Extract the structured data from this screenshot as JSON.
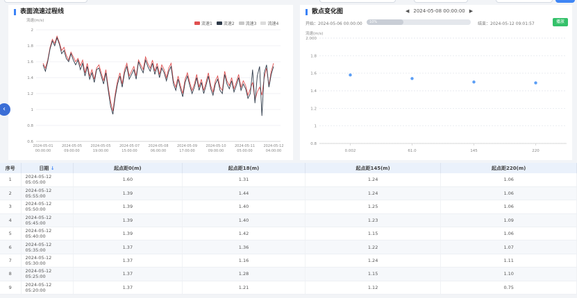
{
  "colors": {
    "accent": "#3b82f6",
    "series_red": "#e05050",
    "series_dark": "#2f3b4a",
    "series_gray1": "#c8c8c8",
    "series_gray2": "#dcdcdc",
    "scatter_point": "#5b9ef5",
    "detail_button": "#34c16a"
  },
  "left_panel": {
    "title": "表面流速过程线",
    "legend": [
      "流速1",
      "流速2",
      "流速3",
      "流速4"
    ]
  },
  "right_panel": {
    "title": "散点变化图",
    "date_nav": {
      "prev_icon": "chevron-left-icon",
      "date": "2024-05-08 00:00:00",
      "next_icon": "chevron-right-icon"
    },
    "start_label": "开始：2024-05-06 00:00:00",
    "slider_tag": "10%",
    "slider_fraction": 0.35,
    "end_label": "结束：2024-05-12 09:01:57",
    "detail_button": "播放"
  },
  "chart_data": [
    {
      "type": "line",
      "ylabel": "流速(m/s)",
      "ylim": [
        0.6,
        2.0
      ],
      "yticks": [
        "2",
        "1.8",
        "1.6",
        "1.4",
        "1.2",
        "1",
        "0.8",
        "0.6"
      ],
      "x_tick_dates": [
        "2024-05-01",
        "2024-05-05",
        "2024-05-05",
        "2024-05-07",
        "2024-05-08",
        "2024-05-09",
        "2024-05-10",
        "2024-05-11",
        "2024-05-12"
      ],
      "x_tick_times": [
        "00:00:00",
        "09:00:00",
        "19:00:00",
        "15:00:00",
        "06:00:00",
        "17:00:00",
        "09:00:00",
        "05:00:00",
        "04:00:00"
      ],
      "series": [
        {
          "color": "#e05050",
          "values": [
            1.58,
            1.52,
            1.62,
            1.78,
            1.88,
            1.83,
            1.92,
            1.84,
            1.74,
            1.78,
            1.68,
            1.62,
            1.72,
            1.66,
            1.6,
            1.64,
            1.55,
            1.62,
            1.46,
            1.58,
            1.42,
            1.5,
            1.38,
            1.52,
            1.56,
            1.46,
            1.36,
            1.5,
            1.28,
            1.1,
            0.98,
            1.2,
            1.36,
            1.46,
            1.32,
            1.5,
            1.58,
            1.42,
            1.48,
            1.54,
            1.42,
            1.62,
            1.56,
            1.5,
            1.66,
            1.58,
            1.52,
            1.62,
            1.48,
            1.58,
            1.44,
            1.56,
            1.5,
            1.4,
            1.52,
            1.58,
            1.36,
            1.28,
            1.42,
            1.3,
            1.2,
            1.38,
            1.46,
            1.34,
            1.24,
            1.32,
            1.44,
            1.28,
            1.38,
            1.24,
            1.34,
            1.46,
            1.3,
            1.22,
            1.36,
            1.42,
            1.28,
            1.24,
            1.48,
            1.36,
            1.3,
            1.4,
            1.26,
            1.34,
            1.44,
            1.28,
            1.36,
            1.3,
            1.18,
            1.26,
            1.34,
            1.12,
            1.22,
            1.28,
            1.18,
            1.4,
            1.52,
            1.3,
            1.48,
            1.58
          ]
        },
        {
          "color": "#2f3b4a",
          "values": [
            1.56,
            1.48,
            1.6,
            1.76,
            1.86,
            1.8,
            1.9,
            1.82,
            1.7,
            1.74,
            1.64,
            1.6,
            1.7,
            1.62,
            1.56,
            1.62,
            1.5,
            1.58,
            1.42,
            1.54,
            1.38,
            1.46,
            1.34,
            1.5,
            1.52,
            1.42,
            1.32,
            1.46,
            1.24,
            1.04,
            0.94,
            1.16,
            1.32,
            1.42,
            1.28,
            1.46,
            1.54,
            1.38,
            1.44,
            1.5,
            1.38,
            1.6,
            1.52,
            1.46,
            1.62,
            1.54,
            1.48,
            1.58,
            1.44,
            1.54,
            1.4,
            1.52,
            1.46,
            1.36,
            1.48,
            1.54,
            1.32,
            1.24,
            1.38,
            1.26,
            1.16,
            1.34,
            1.42,
            1.3,
            1.2,
            1.28,
            1.4,
            1.24,
            1.34,
            1.2,
            1.3,
            1.42,
            1.26,
            1.18,
            1.32,
            1.38,
            1.24,
            1.2,
            1.44,
            1.32,
            1.26,
            1.36,
            1.22,
            1.3,
            1.4,
            1.24,
            1.32,
            1.26,
            1.14,
            1.2,
            1.5,
            1.08,
            1.42,
            1.54,
            0.92,
            1.46,
            1.56,
            1.28,
            1.44,
            1.54
          ]
        }
      ]
    },
    {
      "type": "scatter",
      "ylabel": "流速(m/s)",
      "ylim": [
        0.8,
        2.0
      ],
      "yticks": [
        "2.000",
        "1.8",
        "1.6",
        "1.4",
        "1.2",
        "1",
        "0.8"
      ],
      "categories": [
        "0.002",
        "61.0",
        "145",
        "220"
      ],
      "values": [
        1.58,
        1.54,
        1.5,
        1.49
      ]
    }
  ],
  "table": {
    "headers": [
      "序号",
      "日期",
      "起点距0(m)",
      "起点距18(m)",
      "起点距145(m)",
      "起点距220(m)"
    ],
    "sort_icon": "sort-down-icon",
    "rows": [
      [
        "1",
        "2024-05-12 05:05:00",
        "1.60",
        "1.31",
        "1.24",
        "1.06"
      ],
      [
        "2",
        "2024-05-12 05:55:00",
        "1.39",
        "1.44",
        "1.24",
        "1.06"
      ],
      [
        "3",
        "2024-05-12 05:50:00",
        "1.39",
        "1.40",
        "1.25",
        "1.06"
      ],
      [
        "4",
        "2024-05-12 05:45:00",
        "1.39",
        "1.40",
        "1.23",
        "1.09"
      ],
      [
        "5",
        "2024-05-12 05:40:00",
        "1.39",
        "1.42",
        "1.15",
        "1.06"
      ],
      [
        "6",
        "2024-05-12 05:35:00",
        "1.37",
        "1.36",
        "1.22",
        "1.07"
      ],
      [
        "7",
        "2024-05-12 05:30:00",
        "1.37",
        "1.16",
        "1.24",
        "1.11"
      ],
      [
        "8",
        "2024-05-12 05:25:00",
        "1.37",
        "1.28",
        "1.15",
        "1.10"
      ],
      [
        "9",
        "2024-05-12 05:20:00",
        "1.37",
        "1.21",
        "1.12",
        "0.75"
      ]
    ]
  }
}
